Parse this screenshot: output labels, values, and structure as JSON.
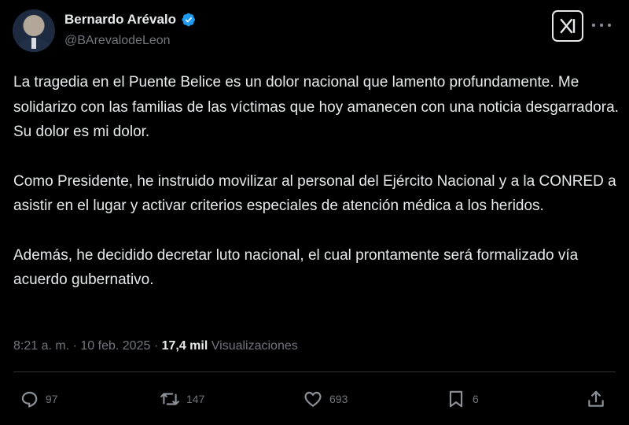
{
  "user": {
    "display_name": "Bernardo Arévalo",
    "handle": "@BArevalodeLeon"
  },
  "tweet": {
    "paragraphs": [
      "La tragedia en el Puente Belice es un dolor nacional que lamento profundamente. Me solidarizo con las familias de las víctimas que hoy amanecen con una noticia desgarradora. Su dolor es mi dolor.",
      "Como Presidente, he instruido movilizar al personal del Ejército Nacional y a la CONRED a asistir en el lugar y activar criterios especiales de atención médica a los heridos.",
      "Además, he decidido decretar luto nacional, el cual prontamente será formalizado vía acuerdo gubernativo."
    ],
    "time": "8:21 a. m.",
    "separator": "·",
    "date": "10 feb. 2025",
    "views_count": "17,4 mil",
    "views_label": "Visualizaciones"
  },
  "actions": {
    "replies": "97",
    "reposts": "147",
    "likes": "693",
    "bookmarks": "6"
  },
  "icons": {
    "verified": "verified-badge-icon",
    "logo": "x-logo-icon",
    "more": "more-icon",
    "reply": "reply-icon",
    "repost": "repost-icon",
    "like": "heart-icon",
    "bookmark": "bookmark-icon",
    "share": "share-icon"
  },
  "colors": {
    "background": "#000000",
    "text": "#e7e9ea",
    "secondary": "#71767b",
    "verified": "#1d9bf0"
  }
}
